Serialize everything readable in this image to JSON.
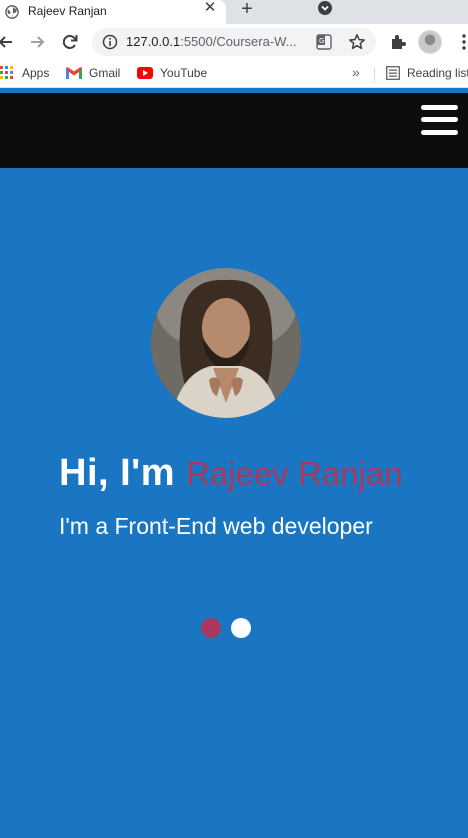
{
  "tab": {
    "title": "Rajeev Ranjan",
    "close": "✕",
    "new_tab": "+"
  },
  "toolbar": {
    "url_host": "127.0.0.1",
    "url_path": ":5500/Coursera-W..."
  },
  "bookmarks": {
    "items": [
      {
        "label": "Apps",
        "icon": "apps-grid-icon"
      },
      {
        "label": "Gmail",
        "icon": "gmail-icon"
      },
      {
        "label": "YouTube",
        "icon": "youtube-icon"
      }
    ],
    "more": "»",
    "reading_list": "Reading list"
  },
  "hero": {
    "greeting": "Hi, I'm",
    "name": "Rajeev Ranjan",
    "tagline": "I'm a Front-End web developer",
    "carousel_dots": 2,
    "active_dot": 1
  },
  "colors": {
    "page_bg": "#1a76c2",
    "header_bg": "#0d0d0d",
    "accent": "#a8395e"
  }
}
